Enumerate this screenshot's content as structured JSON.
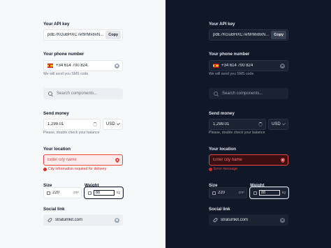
{
  "api_key": {
    "label": "Your API key",
    "value": "pdE7KGuBHXC7ef9rMx8xN...",
    "copy_label": "Copy"
  },
  "phone": {
    "label": "Your phone number",
    "value": "+34 614 700 824",
    "hint": "We will send you SMS code",
    "flag_icon": "spain-flag-icon"
  },
  "search": {
    "placeholder": "Search components..."
  },
  "money": {
    "label": "Send money",
    "value": "1,299.01",
    "currency": "USD",
    "hint": "Please, double check your balance"
  },
  "location": {
    "label": "Your location",
    "placeholder": "Enter city name",
    "error_light": "City information required for delivery",
    "error_dark": "Error message",
    "error_color": "#ef4444"
  },
  "size": {
    "label": "Size",
    "value": "220",
    "unit": "cm²"
  },
  "weight": {
    "label": "Weight",
    "value": "88",
    "unit": "kg"
  },
  "social": {
    "label": "Social link",
    "value": "stratumkit.com"
  },
  "colors": {
    "light_bg": "#f7f8fa",
    "dark_bg": "#101727"
  }
}
